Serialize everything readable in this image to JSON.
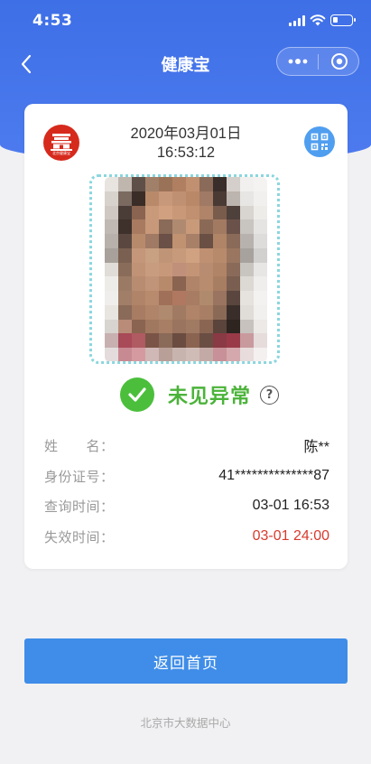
{
  "status_bar": {
    "time": "4:53",
    "battery_level": 0.25
  },
  "nav": {
    "title": "健康宝"
  },
  "card": {
    "logo_text": "北京健康宝",
    "date": "2020年03月01日",
    "time": "16:53:12",
    "status_text": "未见异常",
    "help_glyph": "?",
    "rows": [
      {
        "label": "姓　　名：",
        "value": "陈**"
      },
      {
        "label": "身份证号：",
        "value": "41**************87"
      },
      {
        "label": "查询时间：",
        "value": "03-01 16:53"
      },
      {
        "label": "失效时间：",
        "value": "03-01 24:00"
      }
    ]
  },
  "home_button": {
    "label": "返回首页"
  },
  "footer": {
    "text": "北京市大数据中心"
  },
  "colors": {
    "header": "#3e6fe6",
    "ok_green": "#4bbf3c",
    "expire_red": "#d83a2d",
    "button_blue": "#3f8de8",
    "photo_border": "#8bd6de"
  },
  "icons": {
    "back": "chevron-left-icon",
    "more": "more-dots-icon",
    "close": "target-close-icon",
    "qr": "qr-code-icon",
    "check": "check-icon",
    "help": "question-icon",
    "logo": "tiananmen-logo-icon"
  }
}
